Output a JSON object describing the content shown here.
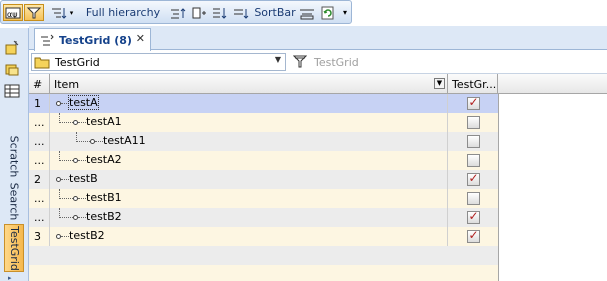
{
  "toolbar": {
    "full_hierarchy": "Full hierarchy",
    "sortbar": "SortBar"
  },
  "sidebar": {
    "tabs": [
      "Scratch",
      "Search",
      "TestGrid"
    ]
  },
  "tab": {
    "title": "TestGrid (8)",
    "close": "✕"
  },
  "combo": {
    "value": "TestGrid",
    "filter_placeholder": "TestGrid"
  },
  "grid": {
    "columns": [
      "#",
      "Item",
      "TestGr..."
    ],
    "rows": [
      {
        "num": "1",
        "label": "testA",
        "checked": true
      },
      {
        "num": "...",
        "label": "testA1",
        "checked": false
      },
      {
        "num": "...",
        "label": "testA11",
        "checked": false
      },
      {
        "num": "...",
        "label": "testA2",
        "checked": false
      },
      {
        "num": "2",
        "label": "testB",
        "checked": true
      },
      {
        "num": "...",
        "label": "testB1",
        "checked": false
      },
      {
        "num": "...",
        "label": "testB2",
        "checked": true
      },
      {
        "num": "3",
        "label": "testB2",
        "checked": true
      }
    ]
  },
  "colors": {
    "row_a": "#fdf6e2",
    "row_b": "#ececec",
    "selected_row": "#c7d2f4",
    "accent": "#15428b"
  }
}
